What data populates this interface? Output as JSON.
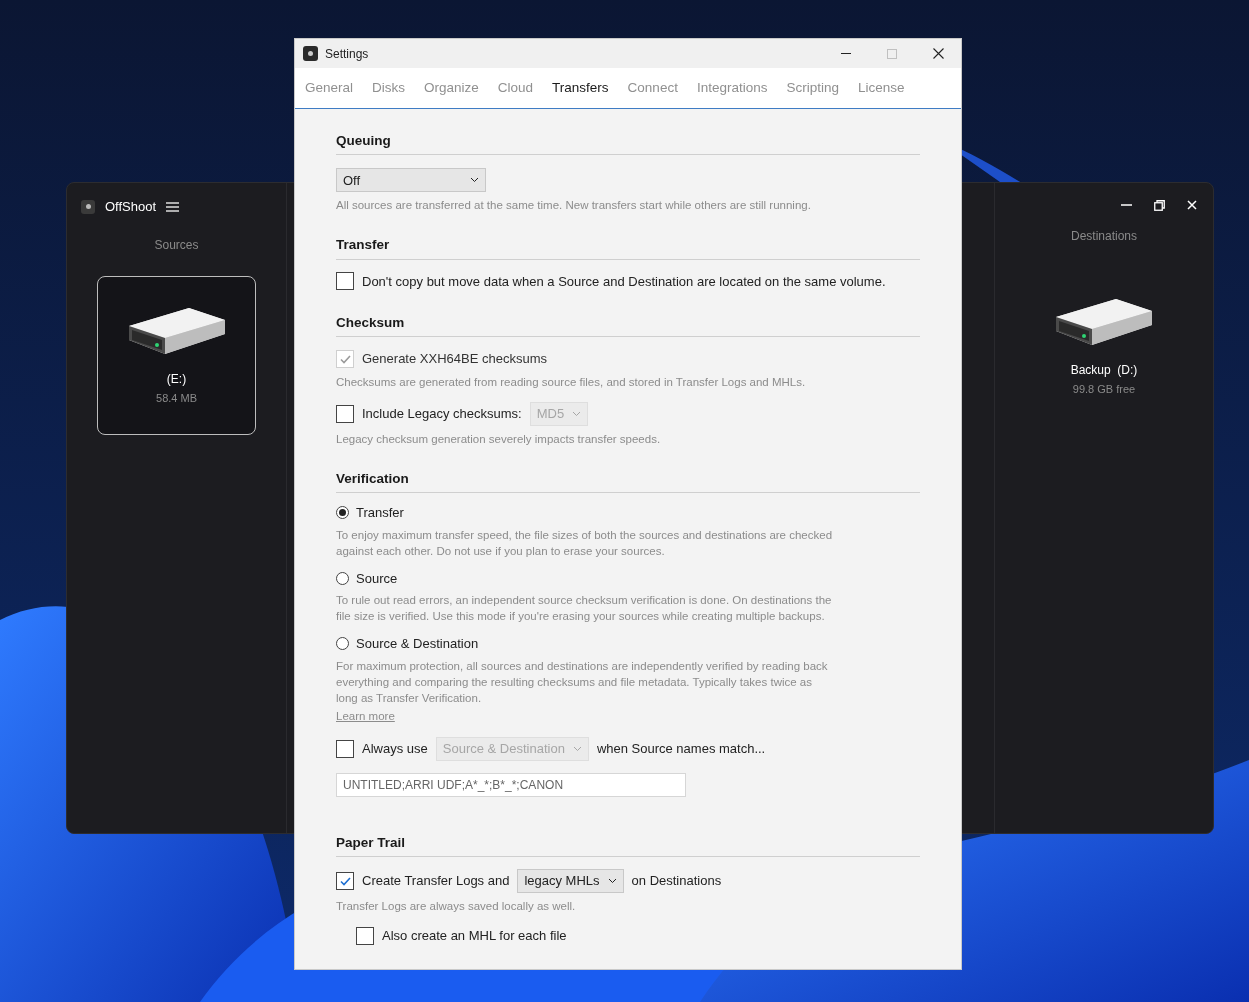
{
  "app_window": {
    "title": "OffShoot",
    "sources_label": "Sources",
    "destinations_label": "Destinations",
    "sources": [
      {
        "name": "(E:)",
        "detail": "58.4 MB",
        "selected": true
      }
    ],
    "destinations": [
      {
        "name": "Backup  (D:)",
        "detail": "99.8 GB free",
        "selected": false
      }
    ]
  },
  "settings": {
    "title": "Settings",
    "tabs": [
      {
        "label": "General",
        "selected": false
      },
      {
        "label": "Disks",
        "selected": false
      },
      {
        "label": "Organize",
        "selected": false
      },
      {
        "label": "Cloud",
        "selected": false
      },
      {
        "label": "Transfers",
        "selected": true
      },
      {
        "label": "Connect",
        "selected": false
      },
      {
        "label": "Integrations",
        "selected": false
      },
      {
        "label": "Scripting",
        "selected": false
      },
      {
        "label": "License",
        "selected": false
      }
    ],
    "sections": [
      {
        "heading": "Queuing",
        "items": [
          {
            "kind": "select",
            "value": "Off",
            "hint": "All sources are transferred at the same time. New transfers start while others are still running."
          }
        ]
      },
      {
        "heading": "Transfer",
        "items": [
          {
            "kind": "checkbox",
            "label": "Don't copy but move data when a Source and Destination are located on the same volume.",
            "checked": false,
            "disabled": false
          }
        ]
      },
      {
        "heading": "Checksum",
        "items": [
          {
            "kind": "checkbox",
            "label": "Generate XXH64BE checksums",
            "checked": true,
            "disabled": true,
            "hint": "Checksums are generated from reading source files, and stored in Transfer Logs and MHLs."
          },
          {
            "kind": "checkbox",
            "label": "Include Legacy checksums:",
            "checked": false,
            "disabled": false,
            "select": {
              "value": "MD5",
              "disabled": true
            },
            "hint": "Legacy checksum generation severely impacts transfer speeds."
          }
        ]
      },
      {
        "heading": "Verification",
        "items": [
          {
            "kind": "radio",
            "label": "Transfer",
            "selected": true,
            "hint": "To enjoy maximum transfer speed, the file sizes of both the sources and destinations are checked against each other. Do not use if you plan to erase your sources."
          },
          {
            "kind": "radio",
            "label": "Source",
            "selected": false,
            "hint": "To rule out read errors, an independent source checksum verification is done. On destinations the file size is verified. Use this mode if you're erasing your sources while creating multiple backups."
          },
          {
            "kind": "radio",
            "label": "Source & Destination",
            "selected": false,
            "hint": "For maximum protection, all sources and destinations are independently verified by reading back everything and comparing the resulting checksums and file metadata. Typically takes twice as long as Transfer Verification."
          },
          {
            "kind": "link",
            "label": "Learn more"
          },
          {
            "kind": "checkbox",
            "label": "Always use",
            "checked": false,
            "disabled": false,
            "select": {
              "value": "Source & Destination",
              "disabled": true
            },
            "suffix": "when Source names match..."
          },
          {
            "kind": "input",
            "value": "UNTITLED;ARRI UDF;A*_*;B*_*;CANON"
          }
        ]
      },
      {
        "heading": "Paper Trail",
        "items": [
          {
            "kind": "checkbox",
            "label": "Create Transfer Logs and",
            "checked": true,
            "disabled": false,
            "select": {
              "value": "legacy MHLs",
              "disabled": false
            },
            "suffix": "on Destinations",
            "hint": "Transfer Logs are always saved locally as well.",
            "children": [
              {
                "kind": "checkbox",
                "label": "Also create an MHL for each file",
                "checked": false,
                "disabled": false
              }
            ]
          }
        ]
      }
    ]
  }
}
